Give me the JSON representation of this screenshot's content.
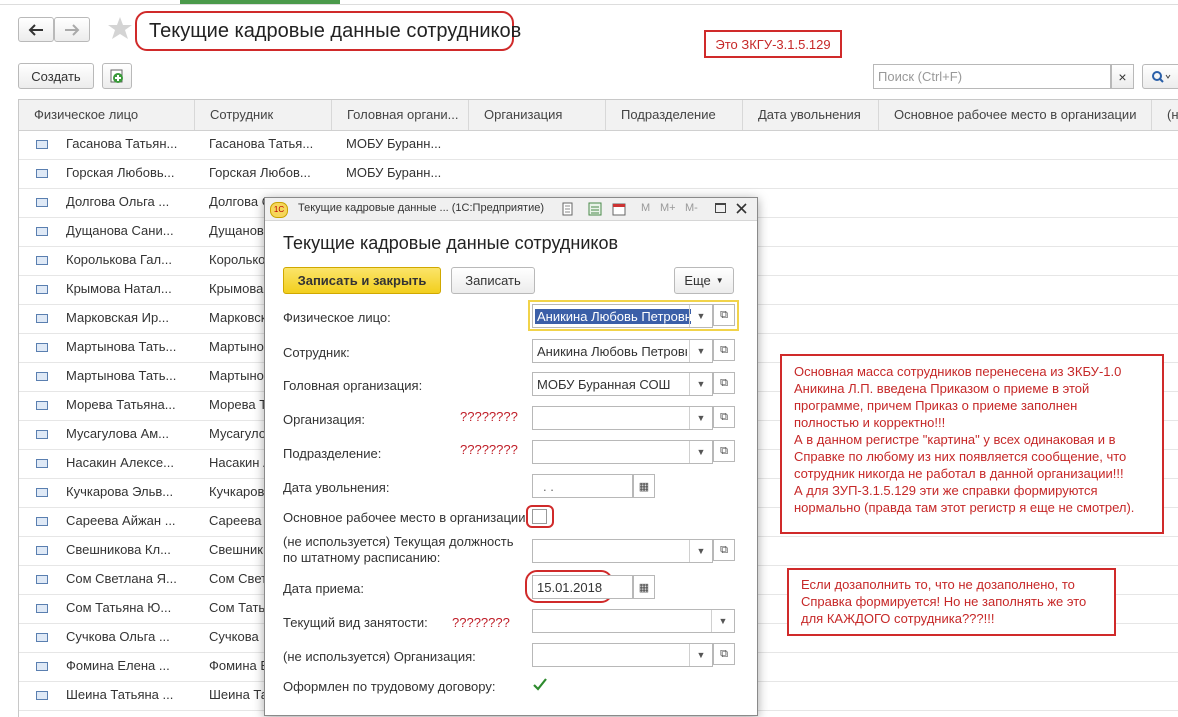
{
  "header": {
    "title": "Текущие кадровые данные сотрудников",
    "version_note": "Это ЗКГУ-3.1.5.129"
  },
  "toolbar": {
    "create_label": "Создать",
    "search_placeholder": "Поиск (Ctrl+F)",
    "clear_label": "×",
    "search_icon": "search-icon"
  },
  "table": {
    "columns": [
      "Физическое лицо",
      "Сотрудник",
      "Головная органи...",
      "Организация",
      "Подразделение",
      "Дата увольнения",
      "Основное рабочее место в организации",
      "(не"
    ],
    "rows": [
      {
        "person": "Гасанова Татьян...",
        "employee": "Гасанова Татья...",
        "head_org": "МОБУ Буранн..."
      },
      {
        "person": "Горская Любовь...",
        "employee": "Горская Любов...",
        "head_org": "МОБУ Буранн..."
      },
      {
        "person": "Долгова Ольга ...",
        "employee": "Долгова О",
        "head_org": ""
      },
      {
        "person": "Дущанова Сани...",
        "employee": "Дущанов",
        "head_org": ""
      },
      {
        "person": "Королькова Гал...",
        "employee": "Королько",
        "head_org": ""
      },
      {
        "person": "Крымова Натал...",
        "employee": "Крымова",
        "head_org": ""
      },
      {
        "person": "Марковская  Ир...",
        "employee": "Марковск",
        "head_org": ""
      },
      {
        "person": "Мартынова Тать...",
        "employee": "Мартыно",
        "head_org": ""
      },
      {
        "person": "Мартынова Тать...",
        "employee": "Мартыно",
        "head_org": ""
      },
      {
        "person": "Морева Татьяна...",
        "employee": "Морева Т",
        "head_org": ""
      },
      {
        "person": "Мусагулова  Ам...",
        "employee": "Мусагуло",
        "head_org": ""
      },
      {
        "person": "Насакин Алексе...",
        "employee": "Насакин А",
        "head_org": ""
      },
      {
        "person": "Кучкарова Эльв...",
        "employee": "Кучкаров",
        "head_org": ""
      },
      {
        "person": "Сареева Айжан ...",
        "employee": "Сареева",
        "head_org": ""
      },
      {
        "person": "Свешникова  Кл...",
        "employee": "Свешник",
        "head_org": ""
      },
      {
        "person": "Сом Светлана Я...",
        "employee": "Сом Свет",
        "head_org": ""
      },
      {
        "person": "Сом Татьяна Ю...",
        "employee": "Сом Тать",
        "head_org": ""
      },
      {
        "person": "Сучкова Ольга ...",
        "employee": "Сучкова",
        "head_org": ""
      },
      {
        "person": "Фомина Елена ...",
        "employee": "Фомина Е",
        "head_org": ""
      },
      {
        "person": "Шеина Татьяна ...",
        "employee": "Шеина Та",
        "head_org": ""
      }
    ]
  },
  "dialog": {
    "window_title": "Текущие кадровые данные ...  (1С:Предприятие)",
    "heading": "Текущие кадровые данные сотрудников",
    "save_close_label": "Записать и закрыть",
    "save_label": "Записать",
    "more_label": "Еще",
    "titlebar_m": "M",
    "titlebar_mplus": "M+",
    "titlebar_mminus": "M-",
    "fields": {
      "person_label": "Физическое лицо:",
      "person_value": "Аникина Любовь Петровна",
      "employee_label": "Сотрудник:",
      "employee_value": "Аникина Любовь Петровна",
      "head_org_label": "Головная организация:",
      "head_org_value": "МОБУ Буранная СОШ",
      "org_label": "Организация:",
      "org_marks": "????????",
      "dept_label": "Подразделение:",
      "dept_marks": "????????",
      "dismissal_label": "Дата увольнения:",
      "dismissal_value": ".  .",
      "main_workplace_label": "Основное рабочее место в организации:",
      "position_label_1": "(не используется) Текущая должность",
      "position_label_2": "по штатному расписанию:",
      "hire_date_label": "Дата приема:",
      "hire_date_value": "15.01.2018",
      "employment_type_label": "Текущий вид занятости:",
      "employment_type_marks": "????????",
      "org_unused_label": "(не используется) Организация:",
      "labor_contract_label": "Оформлен по трудовому договору:"
    }
  },
  "notes": {
    "note1": [
      "Основная масса сотрудников перенесена из ЗКБУ-1.0",
      "Аникина Л.П. введена Приказом о приеме в этой",
      "программе, причем Приказ о приеме заполнен",
      "полностью и корректно!!!",
      "А в данном регистре \"картина\" у всех одинаковая и в",
      "Справке по любому из них появляется сообщение, что",
      "сотрудник никогда не работал в данной организации!!!",
      "А для ЗУП-3.1.5.129 эти же справки формируются",
      "нормально (правда там этот регистр я еще не смотрел)."
    ],
    "note2": [
      "Если дозаполнить то, что не дозаполнено, то",
      "Справка формируется! Но не заполнять же это",
      "для КАЖДОГО сотрудника???!!!"
    ]
  },
  "colors": {
    "accent_yellow": "#f5d73a",
    "annotation_red": "#d02a2a",
    "check_green": "#2e8b2e"
  }
}
